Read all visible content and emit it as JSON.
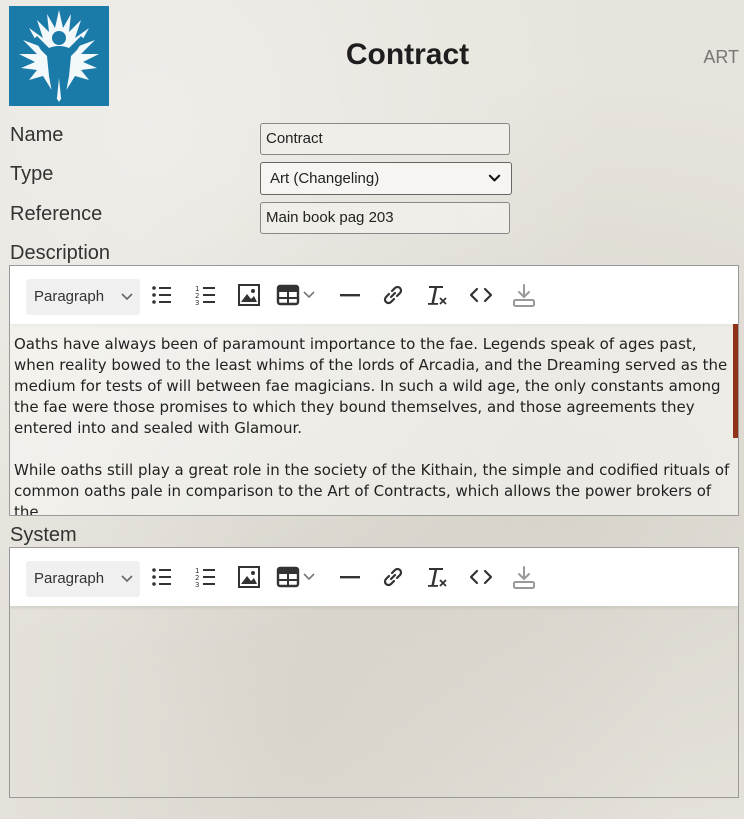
{
  "header": {
    "title": "Contract",
    "type_tag": "ART"
  },
  "form": {
    "name_label": "Name",
    "name_value": "Contract",
    "type_label": "Type",
    "type_value": "Art (Changeling)",
    "reference_label": "Reference",
    "reference_value": "Main book pag 203",
    "description_label": "Description",
    "system_label": "System"
  },
  "editor_toolbar": {
    "format_select": "Paragraph",
    "buttons": [
      "bulleted-list-icon",
      "numbered-list-icon",
      "insert-image-icon",
      "insert-table-icon",
      "horizontal-line-icon",
      "link-icon",
      "remove-format-icon",
      "source-code-icon",
      "download-icon"
    ]
  },
  "description_text": {
    "p1": "Oaths have always been of paramount importance to the fae. Legends speak of ages past, when reality bowed to the least whims of the lords of Arcadia, and the Dreaming served as the medium for tests of will between fae magicians. In such a wild age, the only constants among the fae were those promises to which they bound themselves, and those agreements they entered into and sealed with Glamour.",
    "p2": "While oaths still play a great role in the society of the Kithain, the simple and codified rituals of common oaths pale in comparison to the Art of Contracts, which allows the power brokers of the"
  },
  "colors": {
    "logo_bg": "#1a7aa8",
    "scroll_thumb": "#8e3318"
  }
}
